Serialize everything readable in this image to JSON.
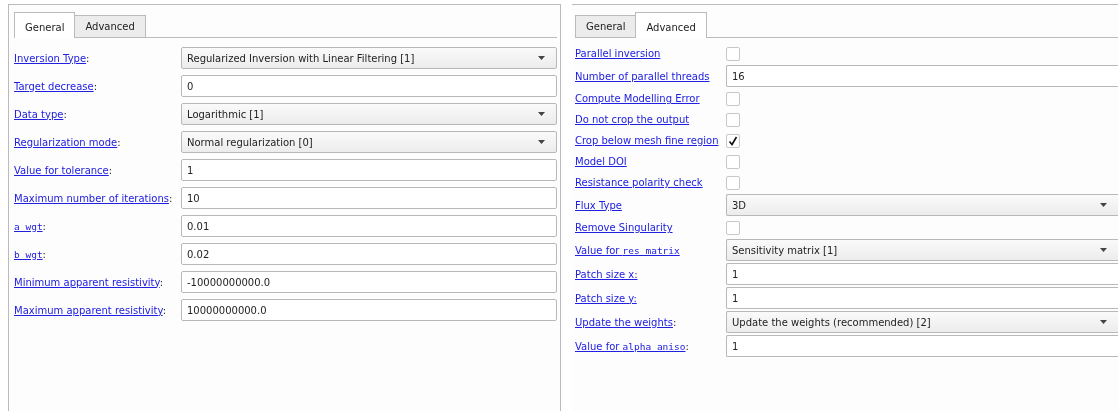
{
  "panels": [
    {
      "tabs": [
        {
          "label": "General",
          "selected": true
        },
        {
          "label": "Advanced",
          "selected": false
        }
      ],
      "rows": [
        {
          "kind": "combo",
          "label": "Inversion Type",
          "suffix": ":",
          "value": "Regularized Inversion with Linear Filtering [1]"
        },
        {
          "kind": "text",
          "label": "Target decrease",
          "suffix": ":",
          "value": "0"
        },
        {
          "kind": "combo",
          "label": "Data type",
          "suffix": ":",
          "value": "Logarithmic [1]"
        },
        {
          "kind": "combo",
          "label": "Regularization mode",
          "suffix": ":",
          "value": "Normal regularization [0]"
        },
        {
          "kind": "text",
          "label": "Value for tolerance",
          "suffix": ":",
          "value": "1"
        },
        {
          "kind": "text",
          "label": "Maximum number of iterations",
          "suffix": ":",
          "value": "10"
        },
        {
          "kind": "text",
          "code": "a_wgt",
          "suffix": ":",
          "value": "0.01"
        },
        {
          "kind": "text",
          "code": "b_wgt",
          "suffix": ":",
          "value": "0.02"
        },
        {
          "kind": "text",
          "label": "Minimum apparent resistivity",
          "suffix": ":",
          "value": "-10000000000.0"
        },
        {
          "kind": "text",
          "label": "Maximum apparent resistivity",
          "suffix": ":",
          "value": "10000000000.0"
        }
      ]
    },
    {
      "tabs": [
        {
          "label": "General",
          "selected": false
        },
        {
          "label": "Advanced",
          "selected": true
        }
      ],
      "rows": [
        {
          "kind": "checkbox",
          "label": "Parallel inversion",
          "checked": false
        },
        {
          "kind": "text",
          "label": "Number of parallel threads",
          "value": "16"
        },
        {
          "kind": "checkbox",
          "label": "Compute Modelling Error",
          "checked": false
        },
        {
          "kind": "checkbox",
          "label": "Do not crop the output",
          "checked": false
        },
        {
          "kind": "checkbox",
          "label": "Crop below mesh fine region",
          "checked": true
        },
        {
          "kind": "checkbox",
          "label": "Model DOI",
          "checked": false
        },
        {
          "kind": "checkbox",
          "label": "Resistance polarity check",
          "checked": false
        },
        {
          "kind": "combo",
          "label": "Flux Type",
          "value": "3D"
        },
        {
          "kind": "checkbox",
          "label": "Remove Singularity",
          "checked": false
        },
        {
          "kind": "combo",
          "label": "Value for ",
          "code": "res_matrix",
          "value": "Sensitivity matrix [1]"
        },
        {
          "kind": "text",
          "label": "Patch size x:",
          "value": "1"
        },
        {
          "kind": "text",
          "label": "Patch size y:",
          "value": "1"
        },
        {
          "kind": "combo",
          "label": "Update the weights",
          "suffix": ":",
          "value": "Update the weights (recommended) [2]"
        },
        {
          "kind": "text",
          "label": "Value for ",
          "code": "alpha_aniso",
          "suffix": ":",
          "value": "1"
        }
      ]
    }
  ]
}
